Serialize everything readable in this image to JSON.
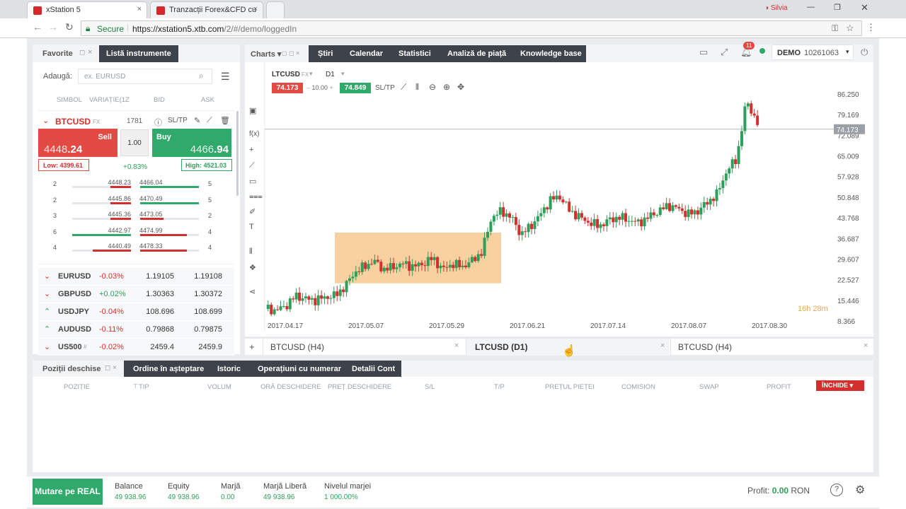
{
  "browser": {
    "tabs": [
      {
        "title": "xStation 5",
        "active": true
      },
      {
        "title": "Tranzacții Forex&CFD cu",
        "active": false
      }
    ],
    "secure_label": "Secure",
    "url_base": "https://xstation5.xtb.com",
    "url_path": "/2/#/demo/loggedIn",
    "profile": "Silvia"
  },
  "left_panel": {
    "tab_favorite": "Favorite",
    "tab_instruments": "Listă instrumente",
    "add_label": "Adaugă:",
    "search_placeholder": "ex. EURUSD",
    "columns": [
      "SIMBOL",
      "VARIAȚIE(1Z",
      "BID",
      "ASK"
    ],
    "main": {
      "symbol": "BTCUSD",
      "type": "FX",
      "volume_count": "1781",
      "sltp": "SL/TP",
      "sell_label": "Sell",
      "sell_big": "4448",
      "sell_small": ".24",
      "buy_label": "Buy",
      "buy_big": "4466",
      "buy_small": ".94",
      "qty": "1.00",
      "low": "Low: 4399.61",
      "change": "+0.83%",
      "high": "High: 4521.03"
    },
    "depth": [
      {
        "l": "2",
        "bid": "4448.23",
        "ask": "4466.04",
        "r": "5",
        "bidf": 0.35,
        "askf": 1.0
      },
      {
        "l": "2",
        "bid": "4445.86",
        "ask": "4470.49",
        "r": "5",
        "bidf": 0.35,
        "askf": 1.0
      },
      {
        "l": "3",
        "bid": "4445.36",
        "ask": "4473.05",
        "r": "2",
        "bidf": 0.35,
        "askf": 0.4
      },
      {
        "l": "6",
        "bid": "4442.97",
        "ask": "4474.99",
        "r": "4",
        "bidf": 1.0,
        "askf": 0.8
      },
      {
        "l": "4",
        "bid": "4440.49",
        "ask": "4478.33",
        "r": "4",
        "bidf": 0.65,
        "askf": 0.8
      }
    ],
    "instruments": [
      {
        "dir": "down",
        "symbol": "EURUSD",
        "tag": "",
        "change": "-0.03%",
        "bid": "1.19105",
        "ask": "1.19108"
      },
      {
        "dir": "down",
        "symbol": "GBPUSD",
        "tag": "",
        "change": "+0.02%",
        "bid": "1.30363",
        "ask": "1.30372"
      },
      {
        "dir": "up",
        "symbol": "USDJPY",
        "tag": "",
        "change": "-0.04%",
        "bid": "108.696",
        "ask": "108.699"
      },
      {
        "dir": "up",
        "symbol": "AUDUSD",
        "tag": "",
        "change": "-0.11%",
        "bid": "0.79868",
        "ask": "0.79875"
      },
      {
        "dir": "down",
        "symbol": "US500",
        "tag": "#",
        "change": "-0.02%",
        "bid": "2459.4",
        "ask": "2459.9"
      }
    ]
  },
  "top_tabs": {
    "charts": "Charts",
    "items": [
      "Știri",
      "Calendar",
      "Statistici",
      "Analiză de piață",
      "Knowledge base"
    ],
    "notif_count": "11",
    "account_mode": "DEMO",
    "account_id": "10261063"
  },
  "chart_toolbar": {
    "symbol": "LTCUSD",
    "type": "FX",
    "interval": "D1",
    "sell_price": "74.173",
    "volume": "10.00",
    "buy_price": "74.849",
    "sltp": "SL/TP",
    "left_tools": [
      "f(x)"
    ]
  },
  "chart_data": {
    "type": "candlestick",
    "symbol": "LTCUSD",
    "interval": "D1",
    "y_ticks": [
      "86.250",
      "79.169",
      "72.089",
      "65.009",
      "57.928",
      "50.848",
      "43.768",
      "36.687",
      "29.607",
      "22.527",
      "15.446",
      "8.366"
    ],
    "x_ticks": [
      "2017.04.17",
      "2017.05.07",
      "2017.05.29",
      "2017.06.21",
      "2017.07.14",
      "2017.08.07",
      "2017.08.30"
    ],
    "current_price": "74.173",
    "countdown": "16h 28m",
    "highlight_color": "#f8c98f",
    "up_color": "#2f9e5a",
    "down_color": "#d0312d",
    "close_path": [
      [
        0,
        12.5
      ],
      [
        5,
        12
      ],
      [
        10,
        13.5
      ],
      [
        15,
        17
      ],
      [
        20,
        16
      ],
      [
        25,
        15.5
      ],
      [
        30,
        16.5
      ],
      [
        35,
        17
      ],
      [
        40,
        20
      ],
      [
        45,
        25
      ],
      [
        50,
        27
      ],
      [
        55,
        29
      ],
      [
        60,
        26
      ],
      [
        65,
        27
      ],
      [
        70,
        28
      ],
      [
        75,
        27
      ],
      [
        80,
        28
      ],
      [
        85,
        30
      ],
      [
        90,
        26
      ],
      [
        95,
        28
      ],
      [
        100,
        27
      ],
      [
        105,
        29
      ],
      [
        110,
        32
      ],
      [
        115,
        44
      ],
      [
        120,
        46
      ],
      [
        125,
        44
      ],
      [
        130,
        38
      ],
      [
        135,
        41
      ],
      [
        140,
        45
      ],
      [
        145,
        50
      ],
      [
        150,
        51
      ],
      [
        155,
        46
      ],
      [
        160,
        44
      ],
      [
        165,
        42
      ],
      [
        170,
        41
      ],
      [
        175,
        43
      ],
      [
        180,
        44
      ],
      [
        185,
        43
      ],
      [
        190,
        42
      ],
      [
        195,
        44
      ],
      [
        200,
        46
      ],
      [
        205,
        48
      ],
      [
        210,
        47
      ],
      [
        215,
        45
      ],
      [
        220,
        46
      ],
      [
        225,
        49
      ],
      [
        230,
        52
      ],
      [
        235,
        60
      ],
      [
        240,
        64
      ],
      [
        245,
        84
      ],
      [
        250,
        77
      ],
      [
        252,
        74
      ]
    ],
    "visible_range_days": [
      0,
      252
    ]
  },
  "chart_tabs": [
    {
      "label": "BTCUSD (H4)",
      "active": false
    },
    {
      "label": "LTCUSD (D1)",
      "active": true
    },
    {
      "label": "BTCUSD (H4)",
      "active": false
    }
  ],
  "bottom": {
    "tabs": [
      "Poziții deschise",
      "Ordine în așteptare",
      "Istoric",
      "Operațiuni cu numerar",
      "Detalii Cont"
    ],
    "columns": [
      "POZIȚIE",
      "TIP",
      "VOLUM",
      "ORĂ DESCHIDERE",
      "PREȚ DESCHIDERE",
      "S/L",
      "T/P",
      "PREȚUL PIEȚEI",
      "COMISION",
      "SWAP",
      "PROFIT"
    ],
    "close_button": "ÎNCHIDE"
  },
  "status": {
    "real_button": "Mutare pe REAL",
    "metrics": [
      {
        "label": "Balance",
        "value": "49 938.96"
      },
      {
        "label": "Equity",
        "value": "49 938.96"
      },
      {
        "label": "Marjă",
        "value": "0.00"
      },
      {
        "label": "Marjă Liberă",
        "value": "49 938.96"
      },
      {
        "label": "Nivelul marjei",
        "value": "1 000.00%"
      }
    ],
    "profit_label": "Profit:",
    "profit_value": "0.00",
    "currency": "RON"
  }
}
